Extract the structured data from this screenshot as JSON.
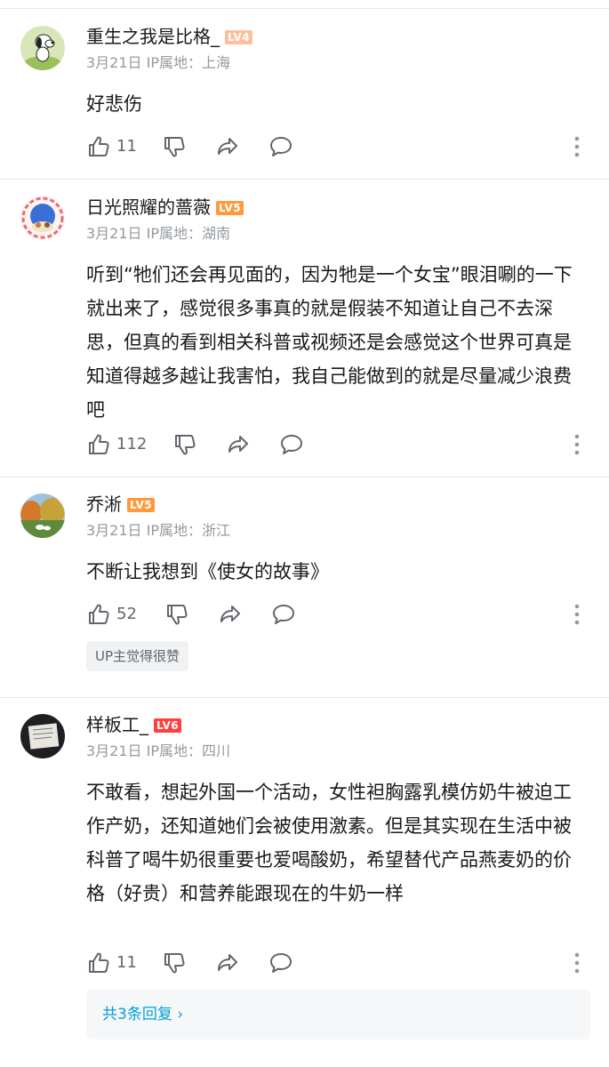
{
  "comments": [
    {
      "username": "重生之我是比格_",
      "level": "LV4",
      "level_color": "#fcbf9e",
      "meta": "3月21日 IP属地：上海",
      "text": "好悲伤",
      "likes": "11"
    },
    {
      "username": "日光照耀的蔷薇",
      "level": "LV5",
      "level_color": "#ff9a3c",
      "meta": "3月21日 IP属地：湖南",
      "text": "听到“牠们还会再见面的，因为牠是一个女宝”眼泪唰的一下就出来了，感觉很多事真的就是假装不知道让自己不去深思，但真的看到相关科普或视频还是会感觉这个世界可真是知道得越多越让我害怕，我自己能做到的就是尽量减少浪费吧",
      "likes": "112"
    },
    {
      "username": "乔淅",
      "level": "LV5",
      "level_color": "#ff9a3c",
      "meta": "3月21日 IP属地：浙江",
      "text": "不断让我想到《使女的故事》",
      "likes": "52",
      "badge": "UP主觉得很赞"
    },
    {
      "username": "样板工_",
      "level": "LV6",
      "level_color": "#ff3f3f",
      "meta": "3月21日 IP属地：四川",
      "text": "不敢看，想起外国一个活动，女性袒胸露乳模仿奶牛被迫工作产奶，还知道她们会被使用激素。但是其实现在生活中被科普了喝牛奶很重要也爱喝酸奶，希望替代产品燕麦奶的价格（好贵）和营养能跟现在的牛奶一样",
      "likes": "11",
      "replies_label": "共3条回复 ›"
    }
  ],
  "icons": {
    "like": "thumbs-up-icon",
    "dislike": "thumbs-down-icon",
    "share": "share-icon",
    "reply": "comment-bubble-icon",
    "more": "more-dots-icon"
  }
}
